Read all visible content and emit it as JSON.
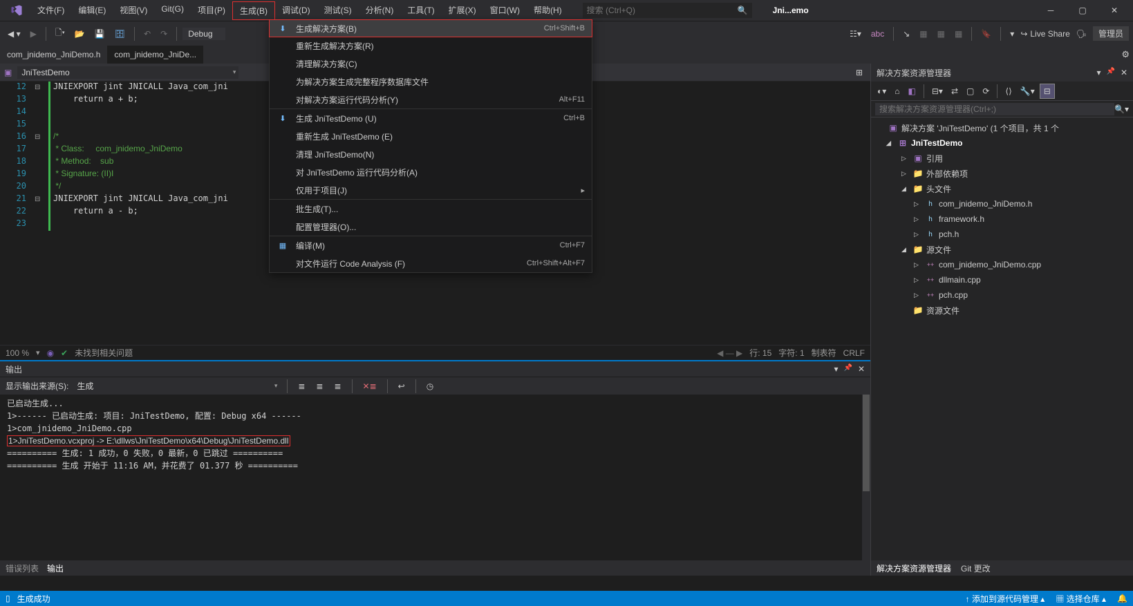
{
  "menu": [
    "文件(F)",
    "编辑(E)",
    "视图(V)",
    "Git(G)",
    "项目(P)",
    "生成(B)",
    "调试(D)",
    "测试(S)",
    "分析(N)",
    "工具(T)",
    "扩展(X)",
    "窗口(W)",
    "帮助(H)"
  ],
  "activeMenuIndex": 5,
  "search_placeholder": "搜索 (Ctrl+Q)",
  "window_title": "Jni...emo",
  "toolbar": {
    "config": "Debug",
    "liveshare": "Live Share",
    "admin": "管理员"
  },
  "tabs": [
    "com_jnidemo_JniDemo.h",
    "com_jnidemo_JniDe..."
  ],
  "activeTab": 1,
  "editor_nav": {
    "scope": "JniTestDemo"
  },
  "code_lines": [
    {
      "n": 12,
      "fold": "⊟",
      "txt": "JNIEXPORT jint JNICALL Java_com_jni                                         b) {"
    },
    {
      "n": 13,
      "txt": "    return a + b;"
    },
    {
      "n": 14,
      "txt": ""
    },
    {
      "n": 15,
      "txt": ""
    },
    {
      "n": 16,
      "fold": "⊟",
      "cmt": "/*"
    },
    {
      "n": 17,
      "cmt": " * Class:     com_jnidemo_JniDemo"
    },
    {
      "n": 18,
      "cmt": " * Method:    sub"
    },
    {
      "n": 19,
      "cmt": " * Signature: (II)I"
    },
    {
      "n": 20,
      "cmt": " */"
    },
    {
      "n": 21,
      "fold": "⊟",
      "txt": "JNIEXPORT jint JNICALL Java_com_jni                                       ) {"
    },
    {
      "n": 22,
      "txt": "    return a - b;"
    },
    {
      "n": 23,
      "txt": ""
    }
  ],
  "zoom": "100 %",
  "issues": "未找到相关问题",
  "status": {
    "line": "行: 15",
    "col": "字符: 1",
    "tab": "制表符",
    "eol": "CRLF"
  },
  "dropdown": [
    {
      "icon": "⬇",
      "label": "生成解决方案(B)",
      "short": "Ctrl+Shift+B",
      "hl": true
    },
    {
      "label": "重新生成解决方案(R)"
    },
    {
      "label": "清理解决方案(C)"
    },
    {
      "label": "为解决方案生成完整程序数据库文件"
    },
    {
      "label": "对解决方案运行代码分析(Y)",
      "short": "Alt+F11"
    },
    {
      "sep": true
    },
    {
      "icon": "⬇",
      "label": "生成 JniTestDemo (U)",
      "short": "Ctrl+B"
    },
    {
      "label": "重新生成 JniTestDemo (E)"
    },
    {
      "label": "清理 JniTestDemo(N)"
    },
    {
      "label": "对 JniTestDemo 运行代码分析(A)"
    },
    {
      "label": "仅用于项目(J)",
      "sub": true
    },
    {
      "sep": true
    },
    {
      "label": "批生成(T)..."
    },
    {
      "label": "配置管理器(O)..."
    },
    {
      "sep": true
    },
    {
      "icon": "▦",
      "label": "编译(M)",
      "short": "Ctrl+F7"
    },
    {
      "label": "对文件运行 Code Analysis (F)",
      "short": "Ctrl+Shift+Alt+F7"
    }
  ],
  "output": {
    "title": "输出",
    "source_label": "显示输出来源(S):",
    "source": "生成",
    "lines": [
      "已启动生成...",
      "1>------ 已启动生成: 项目: JniTestDemo, 配置: Debug x64 ------",
      "1>com_jnidemo_JniDemo.cpp",
      "1>JniTestDemo.vcxproj -> E:\\dllws\\JniTestDemo\\x64\\Debug\\JniTestDemo.dll",
      "========== 生成: 1 成功，0 失败，0 最新，0 已跳过 ==========",
      "========== 生成 开始于 11:16 AM，并花费了 01.377 秒 =========="
    ],
    "annotate_line": 3
  },
  "bottom_tabs": [
    "错误列表",
    "输出"
  ],
  "bottom_active": 1,
  "side": {
    "title": "解决方案资源管理器",
    "search_placeholder": "搜索解决方案资源管理器(Ctrl+;)",
    "root": "解决方案 'JniTestDemo' (1 个项目，共 1 个",
    "project": "JniTestDemo",
    "nodes": [
      {
        "indent": 2,
        "arr": "▷",
        "icon": "▣",
        "label": "引用"
      },
      {
        "indent": 2,
        "arr": "▷",
        "icon": "📁",
        "label": "外部依赖项"
      },
      {
        "indent": 2,
        "arr": "◢",
        "icon": "📁",
        "label": "头文件"
      },
      {
        "indent": 3,
        "arr": "▷",
        "icon": "h",
        "label": "com_jnidemo_JniDemo.h"
      },
      {
        "indent": 3,
        "arr": "▷",
        "icon": "h",
        "label": "framework.h"
      },
      {
        "indent": 3,
        "arr": "▷",
        "icon": "h",
        "label": "pch.h"
      },
      {
        "indent": 2,
        "arr": "◢",
        "icon": "📁",
        "label": "源文件"
      },
      {
        "indent": 3,
        "arr": "▷",
        "icon": "++",
        "label": "com_jnidemo_JniDemo.cpp"
      },
      {
        "indent": 3,
        "arr": "▷",
        "icon": "++",
        "label": "dllmain.cpp"
      },
      {
        "indent": 3,
        "arr": "▷",
        "icon": "++",
        "label": "pch.cpp"
      },
      {
        "indent": 2,
        "arr": "",
        "icon": "📁",
        "label": "资源文件"
      }
    ],
    "bottom_tabs": [
      "解决方案资源管理器",
      "Git 更改"
    ]
  },
  "statusbar": {
    "ready": "生成成功",
    "src_control": "添加到源代码管理",
    "repo": "选择仓库"
  }
}
